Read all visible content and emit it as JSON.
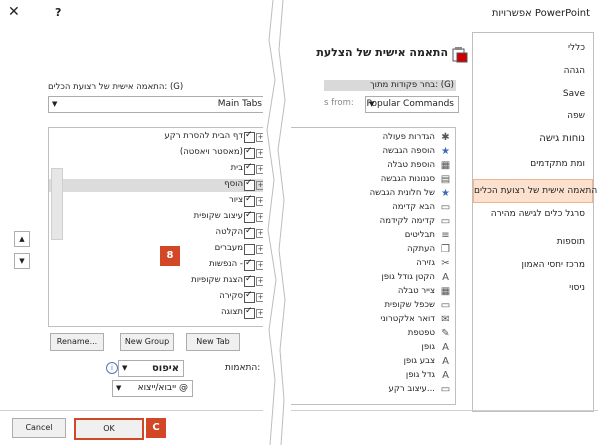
{
  "window": {
    "title": "אפשרויות PowerPoint",
    "help_label": "?",
    "close_label": "✕"
  },
  "categories": [
    {
      "label": "כללי"
    },
    {
      "label": "הגהה"
    },
    {
      "label": "Save"
    },
    {
      "label": "שפה"
    },
    {
      "label": "נוחות גישה"
    },
    {
      "label": "ומת מתקדמים"
    },
    {
      "label": "התאמה אישית של רצועת הכלים"
    },
    {
      "label": "סרגל כלים לגישה מהירה"
    },
    {
      "label": "תוספות"
    },
    {
      "label": "מרכז יחסי האמון"
    },
    {
      "label": "ניסוי"
    }
  ],
  "header": {
    "title": "התאמה אישית של הצלעת",
    "choose_commands_label": "בחר פקודות מתוך: (G) ",
    "choose_commands_ghost": "s from:",
    "commands_combo_value": "Popular Commands",
    "customize_ribbon_label": "התאמה אישית של רצועת הכלים: (G)",
    "ribbon_combo_value": "Main Tabs"
  },
  "commands": [
    "הגדרות פעולה",
    "הוספה הגבשה",
    "הוספת טבלה",
    "סגנונות הגבשה",
    "של חלונית הגבשה",
    "הבא קדימה",
    "קדימה לקידמה",
    "תבליטים",
    "העתקה",
    "גזירה",
    "הקטן גודל גופן",
    "צייר טבלה",
    "שכפל שקופית",
    "דואר אלקטרוני",
    "טפטפת",
    "גופן",
    "צבע גופן",
    "גדל גופן",
    "עיצוב רקע..."
  ],
  "tabs": [
    {
      "label": "דף הבית להסרת רקע",
      "checked": true,
      "expander": "+"
    },
    {
      "label": "(מאסטר ויאסטה)",
      "checked": true,
      "expander": "+"
    },
    {
      "label": "בית",
      "checked": true,
      "expander": "+"
    },
    {
      "label": "הוסף",
      "checked": true,
      "expander": "+"
    },
    {
      "label": "ציור",
      "checked": true,
      "expander": "+"
    },
    {
      "label": "עיצוב שקופית",
      "checked": true,
      "expander": "+"
    },
    {
      "label": "הקלטה",
      "checked": true,
      "expander": "+"
    },
    {
      "label": "מעברים",
      "checked": false,
      "expander": "+"
    },
    {
      "label": "הנפשות -",
      "checked": true,
      "expander": "+"
    },
    {
      "label": "הצגת שקופיות",
      "checked": true,
      "expander": "+"
    },
    {
      "label": "סקירה",
      "checked": true,
      "expander": "+"
    },
    {
      "label": "תצוגה",
      "checked": true,
      "expander": "+"
    }
  ],
  "buttons": {
    "new_tab": "New Tab",
    "new_group": "New Group",
    "rename": "Rename...",
    "reset_label": "התאמות:",
    "reset_value": "איפוס",
    "import_export": "ייבוא/ייצוא @",
    "ok": "OK",
    "cancel": "Cancel"
  },
  "callouts": {
    "eight": "8",
    "c": "C"
  },
  "colors": {
    "accent": "#d24726",
    "selected_category_bg": "#fde1cf",
    "selected_row_bg": "#dcdcdc"
  }
}
